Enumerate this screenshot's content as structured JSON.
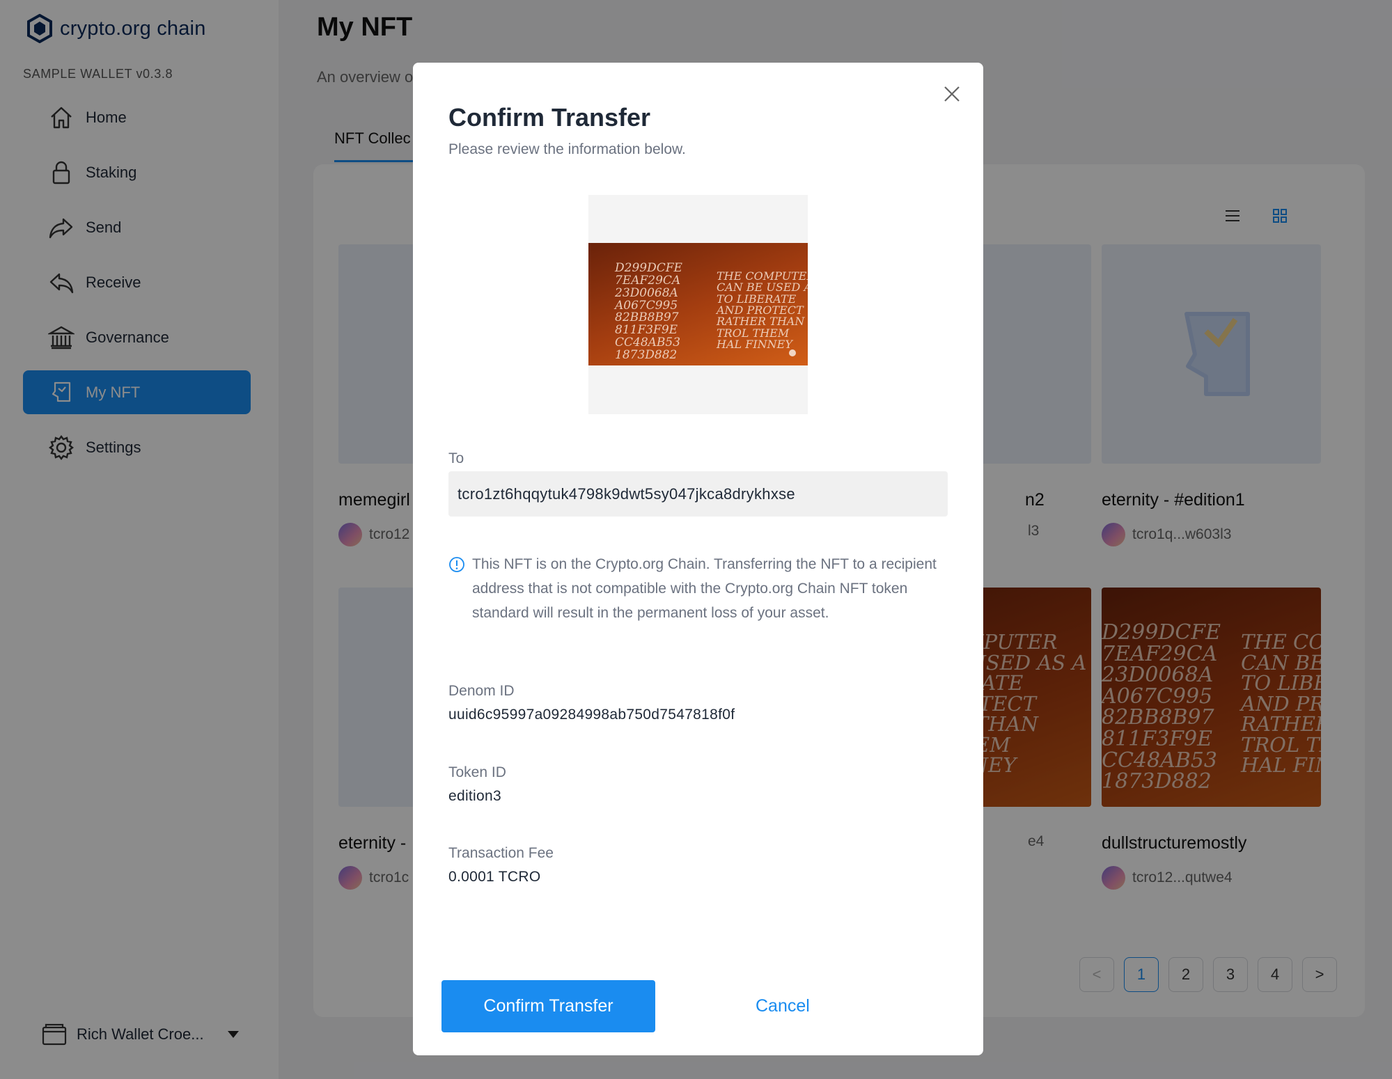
{
  "brand": {
    "name": "crypto.org chain",
    "version": "SAMPLE WALLET v0.3.8"
  },
  "sidebar": {
    "items": [
      {
        "label": "Home",
        "icon": "home-icon"
      },
      {
        "label": "Staking",
        "icon": "lock-icon"
      },
      {
        "label": "Send",
        "icon": "send-icon"
      },
      {
        "label": "Receive",
        "icon": "receive-icon"
      },
      {
        "label": "Governance",
        "icon": "bank-icon"
      },
      {
        "label": "My NFT",
        "icon": "nft-icon",
        "active": true
      },
      {
        "label": "Settings",
        "icon": "gear-icon"
      }
    ],
    "wallet": "Rich Wallet Croe..."
  },
  "page": {
    "title": "My NFT",
    "subtitle": "An overview o",
    "tab": "NFT Collec"
  },
  "cards": [
    {
      "name": "memegirl",
      "owner": "tcro12"
    },
    {
      "name": "n2",
      "owner": "l3"
    },
    {
      "name": "eternity - #edition1",
      "owner": "tcro1q...w603l3"
    },
    {
      "name": "eternity -",
      "owner": "tcro1c"
    },
    {
      "name": "",
      "owner": "e4"
    },
    {
      "name": "dullstructuremostly",
      "owner": "tcro12...qutwe4"
    }
  ],
  "pagination": {
    "pages": [
      "1",
      "2",
      "3",
      "4"
    ],
    "current": "1",
    "prev": "<",
    "next": ">"
  },
  "modal": {
    "title": "Confirm Transfer",
    "subtitle": "Please review the information below.",
    "to_label": "To",
    "to_value": "tcro1zt6hqqytuk4798k9dwt5sy047jkca8drykhxse",
    "notice": "This NFT is on the Crypto.org Chain. Transferring the NFT to a recipient address that is not compatible with the Crypto.org Chain NFT token standard will result in the permanent loss of your asset.",
    "denom_label": "Denom ID",
    "denom_value": "uuid6c95997a09284998ab750d7547818f0f",
    "token_label": "Token ID",
    "token_value": "edition3",
    "fee_label": "Transaction Fee",
    "fee_value": "0.0001 TCRO",
    "confirm_label": "Confirm Transfer",
    "cancel_label": "Cancel"
  },
  "artwork": {
    "left_text": "D299DCFE\n7EAF29CA\n23D0068A\nA067C995\n82BB8B97\n811F3F9E\nCC48AB53\n1873D882",
    "right_text": "THE COMPUTER\nCAN BE USED AS A\nTO LIBERATE\nAND PROTECT\nRATHER THAN\nTROL THEM\nHAL FINNEY"
  },
  "colors": {
    "accent": "#1a8cf0",
    "brand": "#0b2a5b"
  }
}
